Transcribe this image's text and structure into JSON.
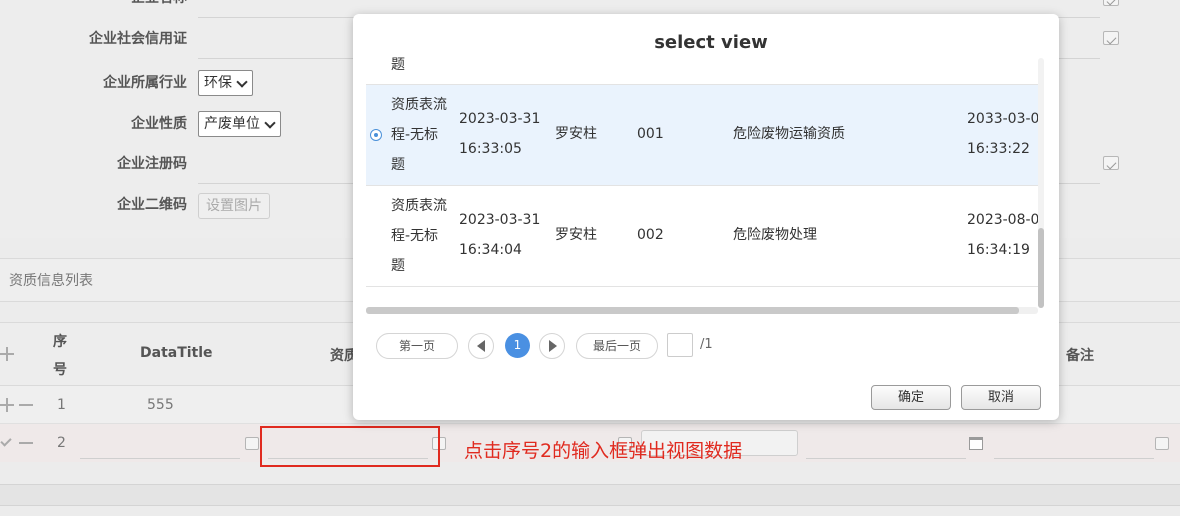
{
  "form": {
    "fields": [
      {
        "label": "企业名称"
      },
      {
        "label": "企业社会信用证"
      },
      {
        "label": "企业所属行业",
        "select": "环保"
      },
      {
        "label": "企业性质",
        "select": "产废单位"
      },
      {
        "label": "企业注册码"
      },
      {
        "label": "企业二维码",
        "button": "设置图片"
      }
    ]
  },
  "section": {
    "title": "资质信息列表"
  },
  "grid": {
    "headers": {
      "seq_line1": "序",
      "seq_line2": "号",
      "datatitle": "DataTitle",
      "qual": "资质",
      "remark": "备注"
    },
    "rows": [
      {
        "seq": "1",
        "datatitle": "555"
      },
      {
        "seq": "2",
        "datatitle": ""
      }
    ]
  },
  "annotation": {
    "text": "点击序号2的输入框弹出视图数据",
    "color": "#e02a1f"
  },
  "modal": {
    "title": "select view",
    "partial_row_text": "题",
    "rows": [
      {
        "title_l1": "资质表流",
        "title_l2": "程-无标",
        "title_l3": "题",
        "date1": "2023-03-31",
        "time1": "16:33:05",
        "person": "罗安柱",
        "code": "001",
        "qual": "危险废物运输资质",
        "date2": "2033-03-0",
        "time2": "16:33:22",
        "selected": true
      },
      {
        "title_l1": "资质表流",
        "title_l2": "程-无标",
        "title_l3": "题",
        "date1": "2023-03-31",
        "time1": "16:34:04",
        "person": "罗安柱",
        "code": "002",
        "qual": "危险废物处理",
        "date2": "2023-08-0",
        "time2": "16:34:19",
        "selected": false
      }
    ],
    "pager": {
      "first": "第一页",
      "current": "1",
      "last": "最后一页",
      "total": "/1"
    },
    "buttons": {
      "ok": "确定",
      "cancel": "取消"
    }
  },
  "colors": {
    "accent": "#4a90e2",
    "selected_row": "#eaf3fd",
    "annotation": "#e02a1f"
  }
}
